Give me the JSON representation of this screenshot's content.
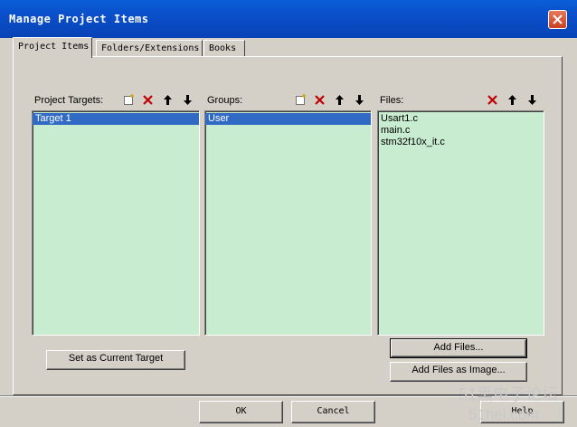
{
  "window": {
    "title": "Manage Project Items"
  },
  "tabs": [
    {
      "label": "Project Items",
      "active": true
    },
    {
      "label": "Folders/Extensions",
      "active": false
    },
    {
      "label": "Books",
      "active": false
    }
  ],
  "targets": {
    "title": "Project Targets:",
    "items": [
      "Target 1"
    ],
    "selected": 0
  },
  "groups": {
    "title": "Groups:",
    "items": [
      "User"
    ],
    "selected": 0
  },
  "files": {
    "title": "Files:",
    "items": [
      "Usart1.c",
      "main.c",
      "stm32f10x_it.c"
    ]
  },
  "buttons": {
    "set_current_target": "Set as Current Target",
    "add_files": "Add Files...",
    "add_files_image": "Add Files as Image...",
    "ok": "OK",
    "cancel": "Cancel",
    "help": "Help"
  },
  "watermark": {
    "line1": "51黑电子论坛",
    "line2": "51hei.com"
  },
  "colors": {
    "list_bg": "#c8ecd0",
    "selection": "#316ac5",
    "titlebar": "#0a4fc9",
    "delete_icon": "#c00000"
  }
}
